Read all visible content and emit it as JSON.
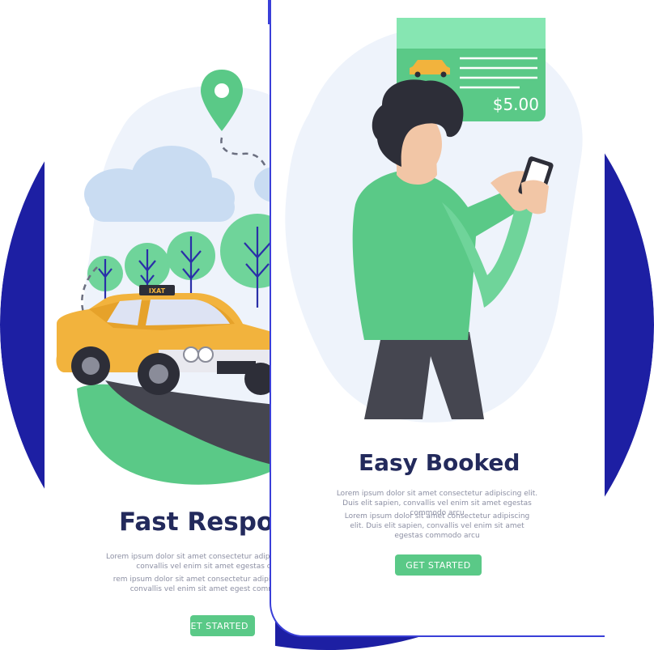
{
  "colors": {
    "background_disc": "#1d1fa3",
    "card_border": "#3a3fd8",
    "accent_green": "#5ac987",
    "title_text": "#232a5c",
    "body_text": "#8c8fa3"
  },
  "left_screen": {
    "title": "Fast Respon",
    "paragraph_1": "Lorem  ipsum  dolor  sit  amet consectetur adipiscing sapien, convallis vel enim sit amet egestas comm",
    "paragraph_2": "rem  ipsum  dolor  sit  amet consectetur adipis it elit sapien, convallis vel enim sit amet egest commodo arcu",
    "button_label": "ET STARTED",
    "taxi_sign": "IXAT",
    "icons": [
      "location-pin-icon",
      "cloud-icon",
      "tree-icon",
      "taxi-icon"
    ]
  },
  "right_screen": {
    "title": "Easy Booked",
    "paragraph_1": "Lorem  ipsum  dolor  sit  amet consectetur adipiscing elit. Duis elit sapien, convallis vel enim sit amet egestas commodo arcu",
    "paragraph_2": "Lorem  ipsum  dolor  sit  amet consectetur adipiscing elit. Duis elit sapien, convallis vel enim sit amet egestas commodo arcu",
    "button_label": "GET STARTED",
    "receipt_price": "$5.00",
    "icons": [
      "receipt-icon",
      "taxi-icon",
      "person-with-phone-icon"
    ]
  }
}
